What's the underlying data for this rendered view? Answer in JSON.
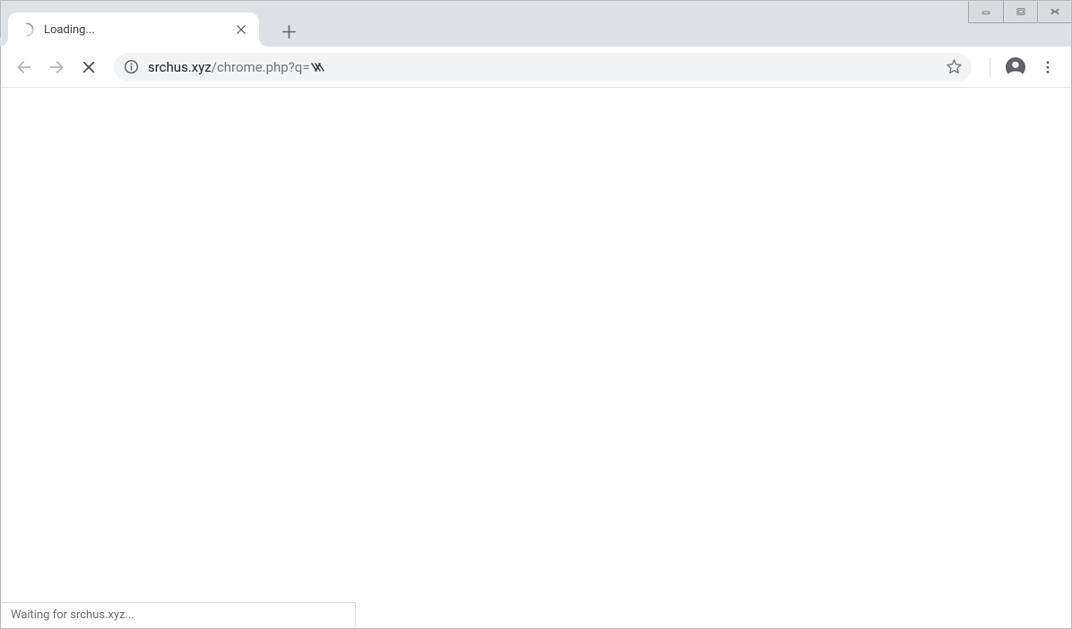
{
  "tab": {
    "title": "Loading..."
  },
  "url": {
    "host": "srchus.xyz",
    "path": "/chrome.php?q="
  },
  "status": {
    "text": "Waiting for srchus.xyz..."
  }
}
